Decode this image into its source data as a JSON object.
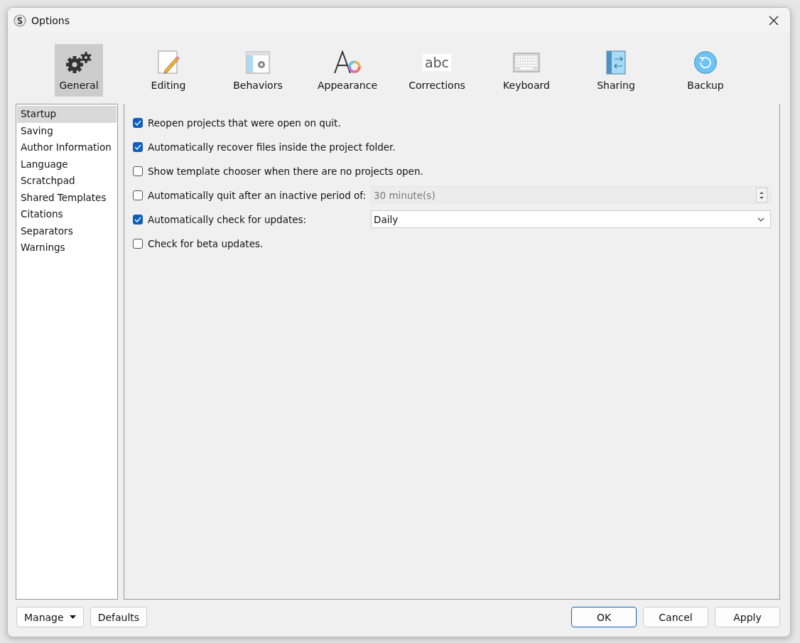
{
  "window": {
    "title": "Options"
  },
  "toolbar": [
    {
      "label": "General",
      "selected": true
    },
    {
      "label": "Editing",
      "selected": false
    },
    {
      "label": "Behaviors",
      "selected": false
    },
    {
      "label": "Appearance",
      "selected": false
    },
    {
      "label": "Corrections",
      "selected": false,
      "icon_text": "abc"
    },
    {
      "label": "Keyboard",
      "selected": false
    },
    {
      "label": "Sharing",
      "selected": false
    },
    {
      "label": "Backup",
      "selected": false
    }
  ],
  "sidebar": {
    "items": [
      {
        "label": "Startup",
        "selected": true
      },
      {
        "label": "Saving",
        "selected": false
      },
      {
        "label": "Author Information",
        "selected": false
      },
      {
        "label": "Language",
        "selected": false
      },
      {
        "label": "Scratchpad",
        "selected": false
      },
      {
        "label": "Shared Templates",
        "selected": false
      },
      {
        "label": "Citations",
        "selected": false
      },
      {
        "label": "Separators",
        "selected": false
      },
      {
        "label": "Warnings",
        "selected": false
      }
    ]
  },
  "options": [
    {
      "kind": "checkbox",
      "label": "Reopen projects that were open on quit.",
      "checked": true
    },
    {
      "kind": "checkbox",
      "label": "Automatically recover files inside the project folder.",
      "checked": true
    },
    {
      "kind": "checkbox",
      "label": "Show template chooser when there are no projects open.",
      "checked": false
    },
    {
      "kind": "spin",
      "label": "Automatically quit after an inactive period of:",
      "checked": false,
      "value": "30 minute(s)",
      "disabled": true
    },
    {
      "kind": "select",
      "label": "Automatically check for updates:",
      "checked": true,
      "value": "Daily"
    },
    {
      "kind": "checkbox",
      "label": "Check for beta updates.",
      "checked": false
    }
  ],
  "buttons": [
    {
      "label": "Manage",
      "kind": "menu"
    },
    {
      "label": "Defaults",
      "kind": "plain"
    },
    {
      "label": "OK",
      "kind": "default"
    },
    {
      "label": "Cancel",
      "kind": "plain"
    },
    {
      "label": "Apply",
      "kind": "plain"
    }
  ]
}
